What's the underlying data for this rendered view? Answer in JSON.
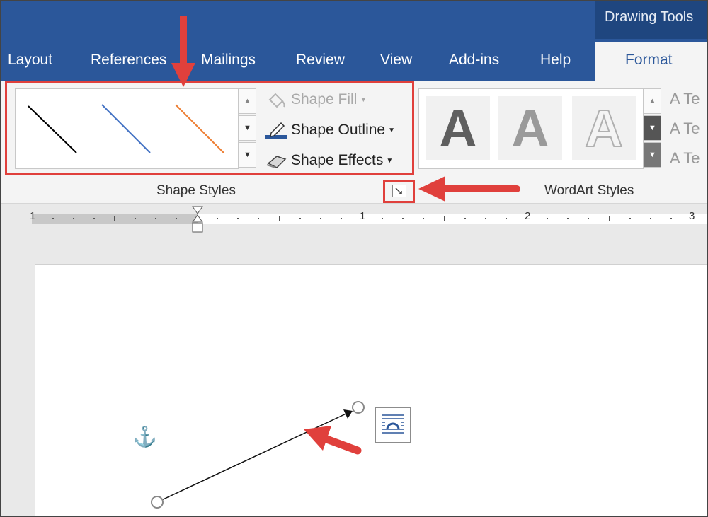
{
  "contextual_tab": "Drawing Tools",
  "tabs": [
    "Layout",
    "References",
    "Mailings",
    "Review",
    "View",
    "Add-ins",
    "Help"
  ],
  "active_tab": "Format",
  "shape_styles": {
    "commands": {
      "fill": "Shape Fill",
      "outline": "Shape Outline",
      "effects": "Shape Effects"
    },
    "group_label": "Shape Styles",
    "line_colors": [
      "#000000",
      "#4472c4",
      "#ed7d31"
    ]
  },
  "wordart": {
    "letter": "A",
    "group_label": "WordArt Styles",
    "text_commands": [
      "Te",
      "Te",
      "Te"
    ]
  },
  "ruler": {
    "numbers": [
      "1",
      "1",
      "2",
      "3"
    ]
  },
  "colors": {
    "accent": "#2b579a",
    "highlight": "#e0403c"
  },
  "icons": [
    "pencil-icon",
    "paint-bucket-icon",
    "eraser-icon",
    "dialog-launcher-icon",
    "anchor-icon",
    "layout-options-icon"
  ]
}
